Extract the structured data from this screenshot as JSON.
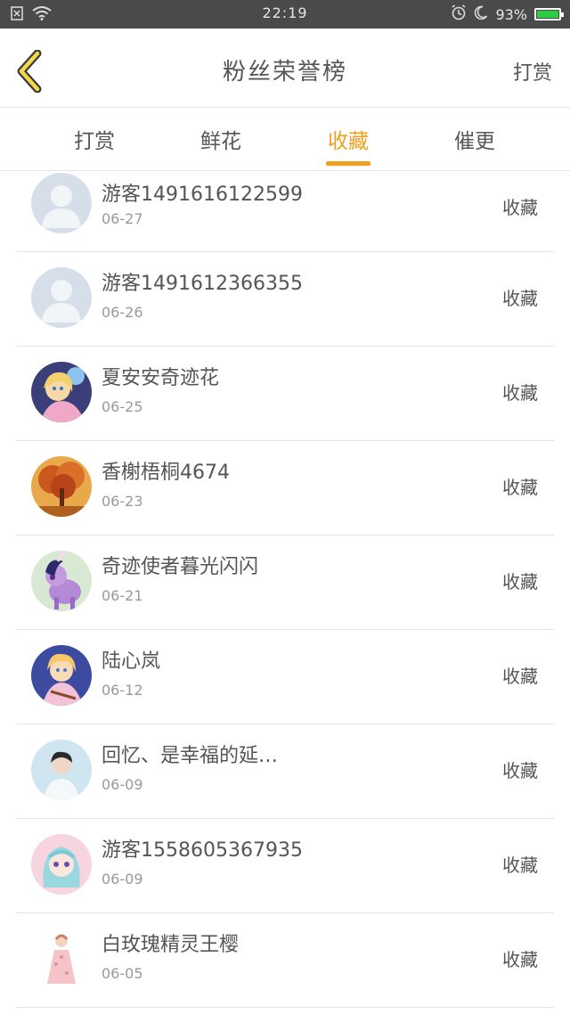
{
  "status_bar": {
    "time": "22:19",
    "battery": "93%",
    "battery_level": 0.93,
    "icons": [
      "close-box-icon",
      "wifi-icon",
      "alarm-icon",
      "moon-icon",
      "battery-icon"
    ]
  },
  "header": {
    "title": "粉丝荣誉榜",
    "right_action": "打赏",
    "back_icon": "chevron-left-icon"
  },
  "tabs": [
    {
      "label": "打赏",
      "active": false
    },
    {
      "label": "鲜花",
      "active": false
    },
    {
      "label": "收藏",
      "active": true
    },
    {
      "label": "催更",
      "active": false
    }
  ],
  "accent_color": "#f0a020",
  "fans": [
    {
      "name": "游客1491616122599",
      "date": "06-27",
      "action": "收藏",
      "avatar": "default-avatar"
    },
    {
      "name": "游客1491612366355",
      "date": "06-26",
      "action": "收藏",
      "avatar": "default-avatar"
    },
    {
      "name": "夏安安奇迹花",
      "date": "06-25",
      "action": "收藏",
      "avatar": "anime-girl-avatar"
    },
    {
      "name": "香榭梧桐4674",
      "date": "06-23",
      "action": "收藏",
      "avatar": "autumn-tree-avatar"
    },
    {
      "name": "奇迹使者暮光闪闪",
      "date": "06-21",
      "action": "收藏",
      "avatar": "pony-avatar"
    },
    {
      "name": "陆心岚",
      "date": "06-12",
      "action": "收藏",
      "avatar": "anime-girl-avatar"
    },
    {
      "name": "回忆、是幸福的延…",
      "date": "06-09",
      "action": "收藏",
      "avatar": "boy-photo-avatar"
    },
    {
      "name": "游客1558605367935",
      "date": "06-09",
      "action": "收藏",
      "avatar": "anime-girl-avatar"
    },
    {
      "name": "白玫瑰精灵王樱",
      "date": "06-05",
      "action": "收藏",
      "avatar": "doll-avatar"
    }
  ]
}
